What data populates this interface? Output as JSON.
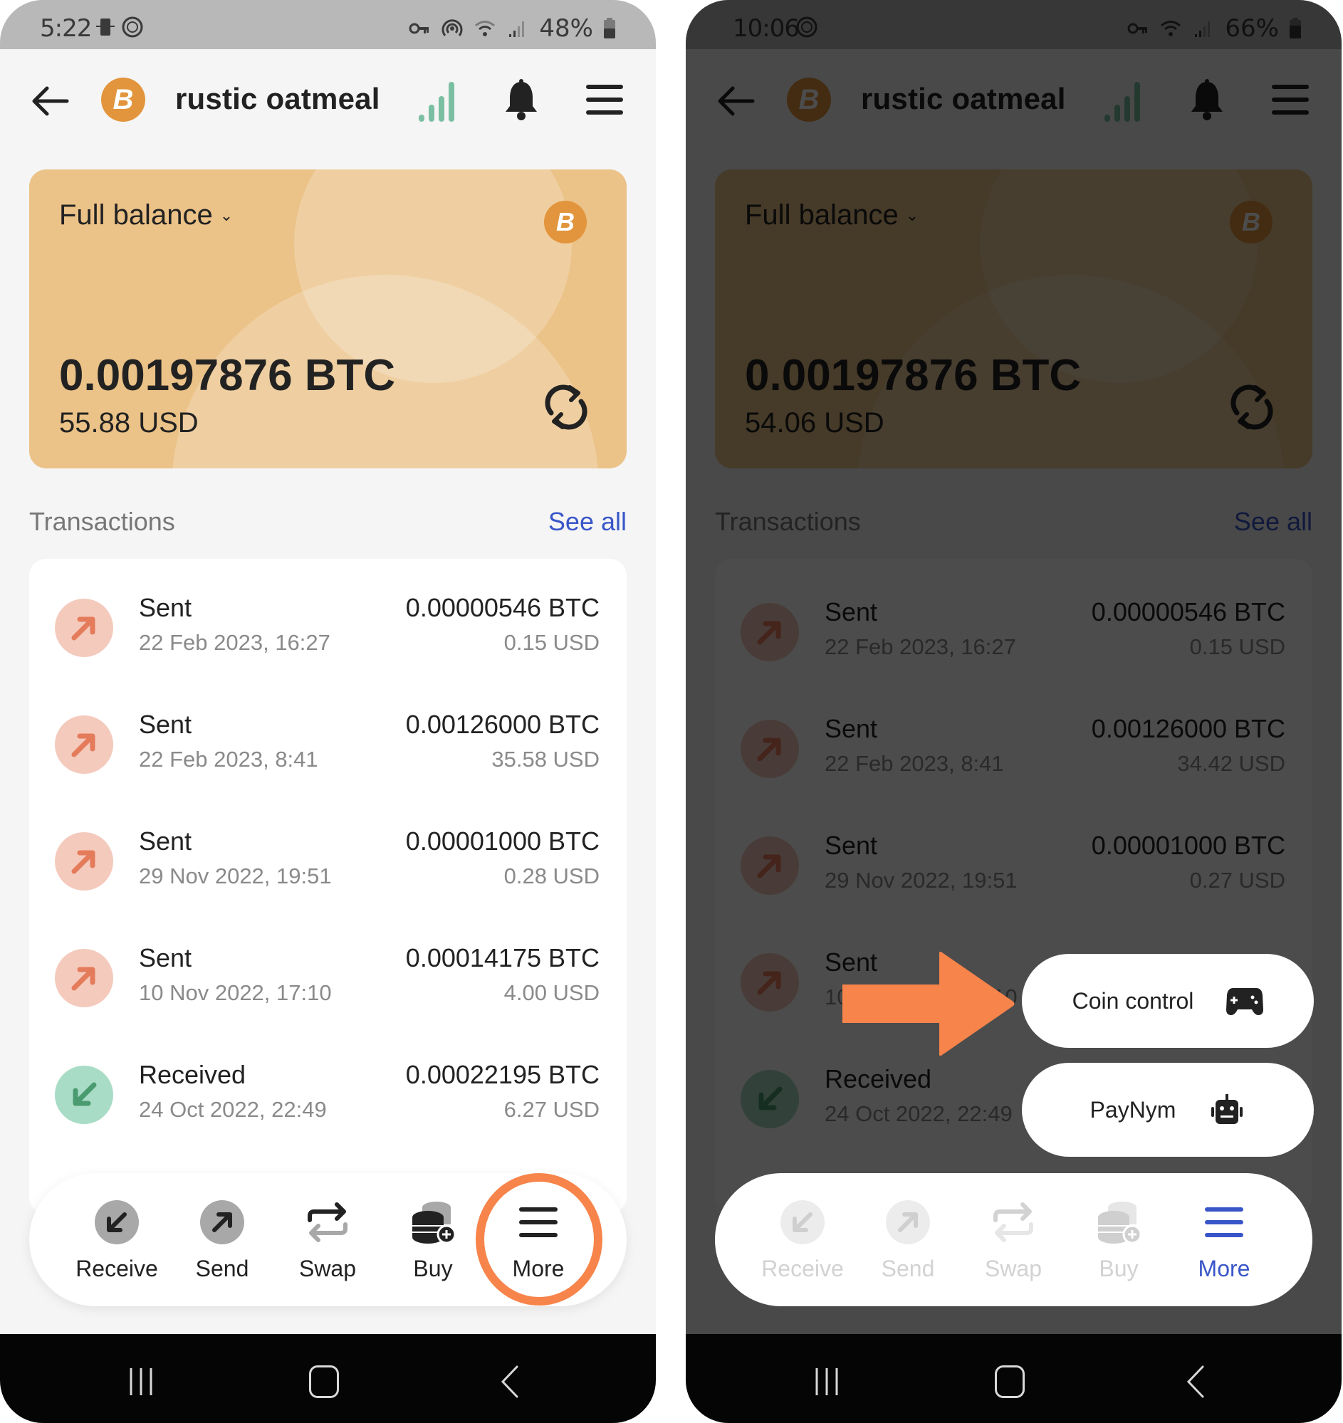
{
  "colors": {
    "accent_blue": "#3956c8",
    "bitcoin_orange": "#e2953c",
    "card_gold": "#ebc287",
    "sent_bg": "#f4cabc",
    "sent_arrow": "#e47b5b",
    "received_bg": "#a9dcc6",
    "received_arrow": "#4a9b70",
    "annotation_orange": "#f7844a",
    "signal_green": "#7bbfa2"
  },
  "left_phone": {
    "status_bar": {
      "time": "5:22",
      "battery": "48%",
      "icons": [
        "vpn-key-icon",
        "hotspot-icon",
        "wifi-icon",
        "cell-signal-icon",
        "battery-icon"
      ]
    },
    "header": {
      "wallet_name": "rustic oatmeal",
      "coin_symbol": "B"
    },
    "balance": {
      "label": "Full balance",
      "btc": "0.00197876 BTC",
      "usd": "55.88 USD"
    },
    "transactions": {
      "heading": "Transactions",
      "see_all": "See all",
      "rows": [
        {
          "type": "Sent",
          "direction": "sent",
          "date": "22 Feb 2023, 16:27",
          "btc": "0.00000546 BTC",
          "usd": "0.15 USD"
        },
        {
          "type": "Sent",
          "direction": "sent",
          "date": "22 Feb 2023, 8:41",
          "btc": "0.00126000 BTC",
          "usd": "35.58 USD"
        },
        {
          "type": "Sent",
          "direction": "sent",
          "date": "29 Nov 2022, 19:51",
          "btc": "0.00001000 BTC",
          "usd": "0.28 USD"
        },
        {
          "type": "Sent",
          "direction": "sent",
          "date": "10 Nov 2022, 17:10",
          "btc": "0.00014175 BTC",
          "usd": "4.00 USD"
        },
        {
          "type": "Received",
          "direction": "received",
          "date": "24 Oct 2022, 22:49",
          "btc": "0.00022195 BTC",
          "usd": "6.27 USD"
        }
      ]
    },
    "actions": [
      {
        "label": "Receive",
        "icon": "receive-icon"
      },
      {
        "label": "Send",
        "icon": "send-icon"
      },
      {
        "label": "Swap",
        "icon": "swap-icon"
      },
      {
        "label": "Buy",
        "icon": "buy-icon"
      },
      {
        "label": "More",
        "icon": "more-menu-icon",
        "highlighted": true
      }
    ]
  },
  "right_phone": {
    "status_bar": {
      "time": "10:06",
      "battery": "66%",
      "icons": [
        "vpn-key-icon",
        "wifi-icon",
        "cell-signal-icon",
        "battery-icon"
      ]
    },
    "header": {
      "wallet_name": "rustic oatmeal",
      "coin_symbol": "B"
    },
    "balance": {
      "label": "Full balance",
      "btc": "0.00197876 BTC",
      "usd": "54.06 USD"
    },
    "transactions": {
      "heading": "Transactions",
      "see_all": "See all",
      "rows": [
        {
          "type": "Sent",
          "direction": "sent",
          "date": "22 Feb 2023, 16:27",
          "btc": "0.00000546 BTC",
          "usd": "0.15 USD"
        },
        {
          "type": "Sent",
          "direction": "sent",
          "date": "22 Feb 2023, 8:41",
          "btc": "0.00126000 BTC",
          "usd": "34.42 USD"
        },
        {
          "type": "Sent",
          "direction": "sent",
          "date": "29 Nov 2022, 19:51",
          "btc": "0.00001000 BTC",
          "usd": "0.27 USD"
        },
        {
          "type": "Sent",
          "direction": "sent",
          "date": "10 Nov 2022, 17:10",
          "btc": "",
          "usd": ""
        },
        {
          "type": "Received",
          "direction": "received",
          "date": "24 Oct 2022, 22:49",
          "btc": "",
          "usd": ""
        }
      ]
    },
    "popup_menu": [
      {
        "label": "Coin control",
        "icon": "gamepad-icon"
      },
      {
        "label": "PayNym",
        "icon": "robot-icon"
      }
    ],
    "actions": [
      {
        "label": "Receive",
        "icon": "receive-icon",
        "disabled": true
      },
      {
        "label": "Send",
        "icon": "send-icon",
        "disabled": true
      },
      {
        "label": "Swap",
        "icon": "swap-icon",
        "disabled": true
      },
      {
        "label": "Buy",
        "icon": "buy-icon",
        "disabled": true
      },
      {
        "label": "More",
        "icon": "more-menu-icon",
        "active": true
      }
    ]
  }
}
